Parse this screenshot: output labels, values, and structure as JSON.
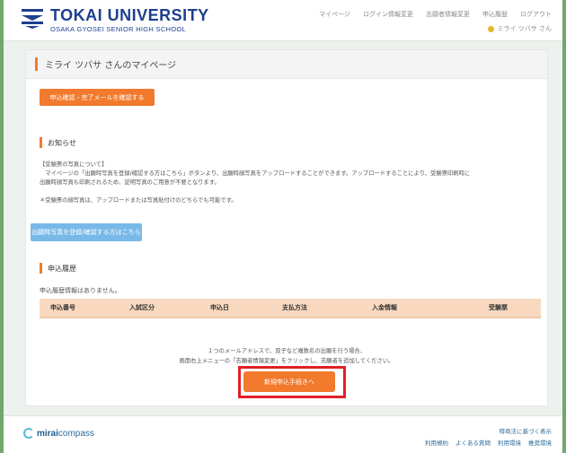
{
  "header": {
    "logo_title": "TOKAI UNIVERSITY",
    "logo_subtitle": "OSAKA GYOSEI SENIOR HIGH SCHOOL",
    "nav": [
      "マイページ",
      "ログイン情報変更",
      "志願者情報変更",
      "申込履歴",
      "ログアウト"
    ],
    "user_name": "ミライ ツバサ さん"
  },
  "page": {
    "title": "ミライ ツバサ さんのマイページ",
    "confirm_mail_button": "申込確認・完了メールを確認する",
    "notice_title": "お知らせ",
    "notice_lines": [
      "【受験票の写真について】",
      "　マイページの「出願時写真を登録/確認する方はこちら」ボタンより、出願時顔写真をアップロードすることができます。アップロードすることにより、受験票印刷時に",
      "出願時顔写真も印刷されるため、証明写真のご用意が不要となります。",
      "",
      "＊受験票の顔写真は、アップロードまたは写真貼付けのどちらでも可能です。"
    ],
    "photo_button": "出願時写真を登録/確認する方はこちら",
    "history_title": "申込履歴",
    "history_empty": "申込履歴情報はありません。",
    "history_columns": [
      "申込番号",
      "入試区分",
      "申込日",
      "支払方法",
      "入金情報",
      "受験票"
    ],
    "footnote_lines": [
      "１つのメールアドレスで、双子など複数名の出願を行う場合、",
      "画面右上メニューの「志願者情報変更」をクリックし、志願者を追加してください。"
    ],
    "new_application_button": "新規申込手続きへ"
  },
  "footer": {
    "brand_prefix": "mirai",
    "brand_suffix": "compass",
    "top_link": "特商法に基づく表示",
    "links": [
      "利用規約",
      "よくある質問",
      "利用環境",
      "推奨環境"
    ]
  },
  "colors": {
    "accent_orange": "#f17a2d",
    "highlight_red": "#e21f26",
    "brand_blue": "#1d3f8f",
    "table_header": "#f8d9bf"
  }
}
